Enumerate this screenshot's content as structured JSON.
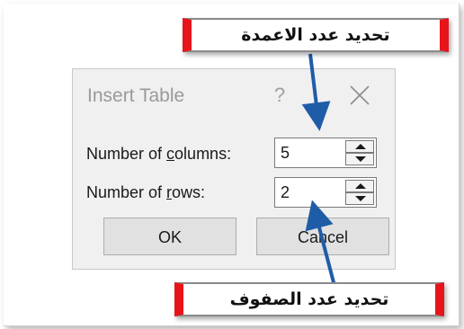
{
  "dialog": {
    "title": "Insert Table",
    "help_label": "?",
    "columns_label_pre": "Number of ",
    "columns_label_ul": "c",
    "columns_label_post": "olumns:",
    "columns_value": "5",
    "rows_label_pre": "Number of ",
    "rows_label_ul": "r",
    "rows_label_post": "ows:",
    "rows_value": "2",
    "ok_label": "OK",
    "cancel_label": "Cancel"
  },
  "annotations": {
    "columns_note": "تحديد عدد الاعمدة",
    "rows_note": "تحديد عدد الصفوف"
  },
  "colors": {
    "callout_border": "#e8141b",
    "arrow": "#1f5ca8"
  },
  "icons": {
    "close": "close-icon",
    "spin_up": "triangle-up-icon",
    "spin_down": "triangle-down-icon"
  }
}
